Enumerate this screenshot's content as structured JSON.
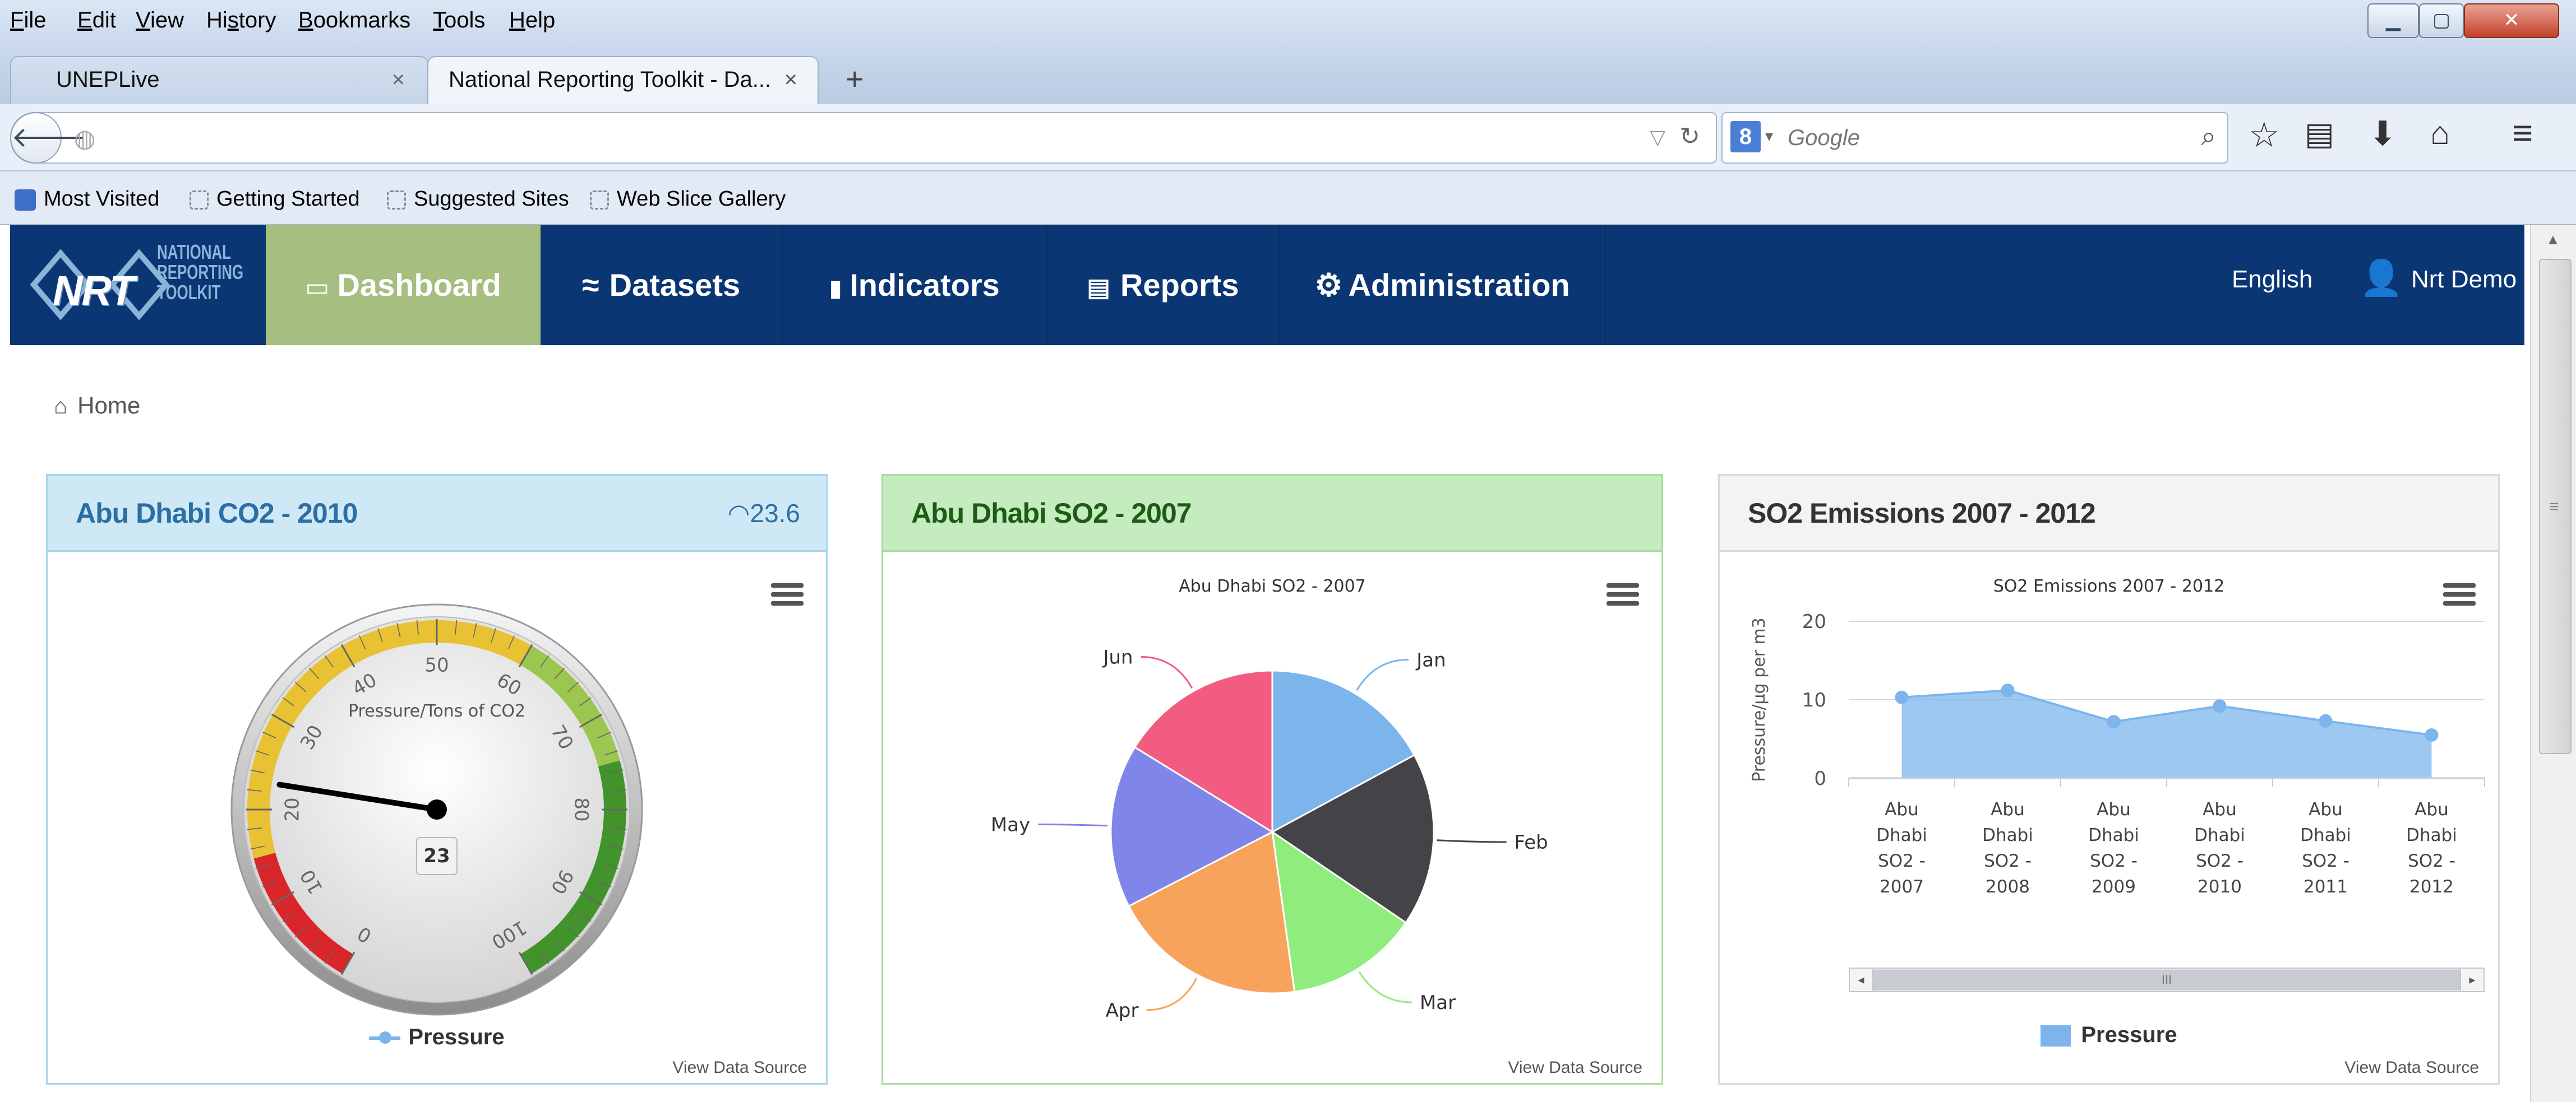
{
  "menubar": {
    "items": [
      {
        "label": "File",
        "key": "F",
        "rest": "ile"
      },
      {
        "label": "Edit",
        "key": "E",
        "rest": "dit"
      },
      {
        "label": "View",
        "key": "V",
        "rest": "iew"
      },
      {
        "label": "History",
        "pre": "Hi",
        "key": "s",
        "rest": "tory"
      },
      {
        "label": "Bookmarks",
        "key": "B",
        "rest": "ookmarks"
      },
      {
        "label": "Tools",
        "key": "T",
        "rest": "ools"
      },
      {
        "label": "Help",
        "key": "H",
        "rest": "elp"
      }
    ]
  },
  "tabs": [
    {
      "label": "UNEPLive",
      "close": "×"
    },
    {
      "label": "National Reporting Toolkit - Da...",
      "close": "×"
    }
  ],
  "new_tab": "+",
  "navbar": {
    "url": "",
    "search_engine": "8",
    "search_placeholder": "Google"
  },
  "bookmarks": [
    "Most Visited",
    "Getting Started",
    "Suggested Sites",
    "Web Slice Gallery"
  ],
  "app": {
    "logo": {
      "mark": "NRT",
      "line1": "NATIONAL",
      "line2": "REPORTING",
      "line3": "TOOLKIT"
    },
    "nav": [
      {
        "label": "Dashboard",
        "icon": "laptop-icon",
        "glyph": "▭",
        "active": true
      },
      {
        "label": "Datasets",
        "icon": "chart-line-icon",
        "glyph": "≈",
        "active": false
      },
      {
        "label": "Indicators",
        "icon": "bar-chart-icon",
        "glyph": "▮",
        "active": false
      },
      {
        "label": "Reports",
        "icon": "report-icon",
        "glyph": "▤",
        "active": false
      },
      {
        "label": "Administration",
        "icon": "cogs-icon",
        "glyph": "⚙",
        "active": false
      }
    ],
    "language": "English",
    "user": "Nrt Demo",
    "breadcrumb": "Home",
    "colors": {
      "nav_bg": "#0b3674",
      "active_bg": "#a6be80"
    }
  },
  "panels": {
    "gauge": {
      "title": "Abu Dhabi CO2 - 2010",
      "badge": "23.6",
      "view_source": "View Data Source",
      "legend": "Pressure",
      "colors": {
        "header_bg": "#cfe8f6",
        "title": "#2b6fa4"
      }
    },
    "pie": {
      "title": "Abu Dhabi SO2 - 2007",
      "view_source": "View Data Source",
      "colors": {
        "header_bg": "#c5ecbf",
        "title": "#1e5b16"
      }
    },
    "area": {
      "title": "SO2 Emissions 2007 - 2012",
      "view_source": "View Data Source",
      "legend": "Pressure",
      "scroll_thumb": "III",
      "colors": {
        "header_bg": "#f3f3f3",
        "title": "#333333"
      }
    }
  },
  "chart_data": [
    {
      "type": "gauge",
      "title": "Pressure/Tons of CO2",
      "value": 23,
      "range": [
        0,
        100
      ],
      "ticks": [
        0,
        10,
        20,
        30,
        40,
        50,
        60,
        70,
        80,
        90,
        100
      ],
      "bands": [
        {
          "from": 0,
          "to": 15,
          "color": "#d9262b"
        },
        {
          "from": 15,
          "to": 60,
          "color": "#e8c233"
        },
        {
          "from": 60,
          "to": 75,
          "color": "#9bc64f"
        },
        {
          "from": 75,
          "to": 100,
          "color": "#43932c"
        }
      ],
      "series": [
        {
          "name": "Pressure",
          "values": [
            23
          ]
        }
      ]
    },
    {
      "type": "pie",
      "title": "Abu Dhabi SO2 - 2007",
      "categories": [
        "Jan",
        "Feb",
        "Mar",
        "Apr",
        "May",
        "Jun"
      ],
      "values": [
        17.1,
        17.4,
        13.3,
        19.6,
        16.4,
        16.2
      ],
      "colors": [
        "#7cb5ec",
        "#434348",
        "#90ed7d",
        "#f7a35c",
        "#8085e9",
        "#f15c80"
      ]
    },
    {
      "type": "area",
      "title": "SO2 Emissions 2007 - 2012",
      "ylabel": "Pressure/µg per m3",
      "ylim": [
        0,
        20
      ],
      "yticks": [
        0,
        10,
        20
      ],
      "categories": [
        [
          "Abu",
          "Dhabi",
          "SO2 -",
          "2007"
        ],
        [
          "Abu",
          "Dhabi",
          "SO2 -",
          "2008"
        ],
        [
          "Abu",
          "Dhabi",
          "SO2 -",
          "2009"
        ],
        [
          "Abu",
          "Dhabi",
          "SO2 -",
          "2010"
        ],
        [
          "Abu",
          "Dhabi",
          "SO2 -",
          "2011"
        ],
        [
          "Abu",
          "Dhabi",
          "SO2 -",
          "2012"
        ]
      ],
      "series": [
        {
          "name": "Pressure",
          "values": [
            10.3,
            11.2,
            7.2,
            9.2,
            7.3,
            5.5
          ],
          "color": "#7cb5ec"
        }
      ],
      "grid": true
    }
  ]
}
